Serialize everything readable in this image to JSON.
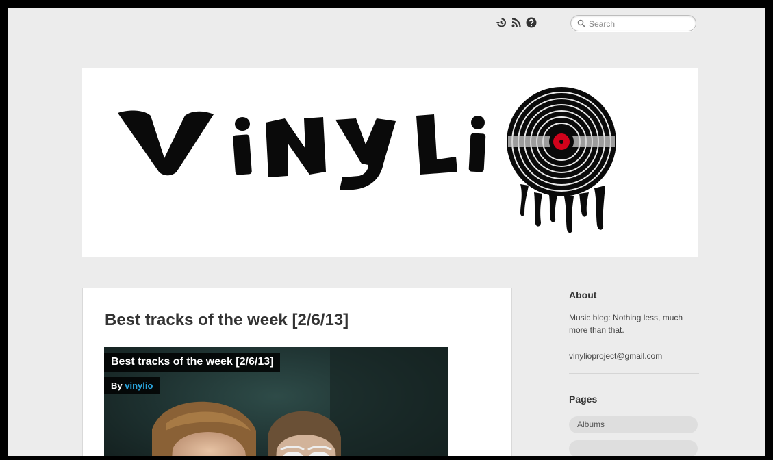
{
  "topbar": {
    "icons": [
      "history-icon",
      "rss-icon",
      "help-icon"
    ],
    "search": {
      "placeholder": "Search",
      "value": ""
    }
  },
  "header": {
    "logo_text": "ViNyLi",
    "colors": {
      "logo": "#0a0a0a",
      "record_center": "#d0021b"
    }
  },
  "post": {
    "title": "Best tracks of the week [2/6/13]",
    "image_caption_title": "Best tracks of the week [2/6/13]",
    "by_label": "By",
    "author": "vinylio"
  },
  "sidebar": {
    "about": {
      "title": "About",
      "text": "Music blog: Nothing less, much more than that.",
      "email": "vinylioproject@gmail.com"
    },
    "pages": {
      "title": "Pages",
      "items": [
        "Albums"
      ]
    }
  },
  "colors": {
    "page_bg": "#ececec",
    "link": "#2ba6de",
    "title": "#333333"
  }
}
